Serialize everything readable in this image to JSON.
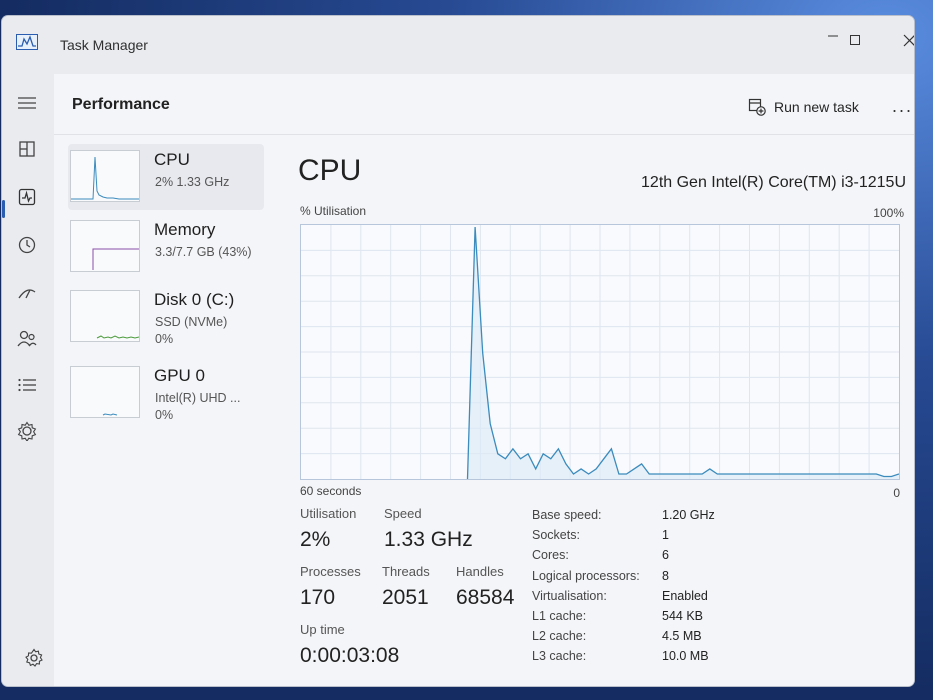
{
  "window": {
    "title": "Task Manager"
  },
  "header": {
    "title": "Performance",
    "run_new_task": "Run new task",
    "more": "..."
  },
  "sidebar": {
    "icons": [
      "hamburger-menu-icon",
      "processes-icon",
      "performance-icon",
      "app-history-icon",
      "startup-apps-icon",
      "users-icon",
      "details-icon",
      "services-icon",
      "settings-icon"
    ],
    "active": "performance-icon"
  },
  "perf_list": [
    {
      "name": "CPU",
      "line1": "2% 1.33 GHz",
      "line2": "",
      "color": "#3b8bbd",
      "selected": true
    },
    {
      "name": "Memory",
      "line1": "3.3/7.7 GB (43%)",
      "line2": "",
      "color": "#8b4fa8",
      "selected": false
    },
    {
      "name": "Disk 0 (C:)",
      "line1": "SSD (NVMe)",
      "line2": "0%",
      "color": "#4b9a3b",
      "selected": false
    },
    {
      "name": "GPU 0",
      "line1": "Intel(R) UHD ...",
      "line2": "0%",
      "color": "#3b8bbd",
      "selected": false
    }
  ],
  "detail": {
    "title": "CPU",
    "model": "12th Gen Intel(R) Core(TM) i3-1215U",
    "util_label": "% Utilisation",
    "max_label": "100%",
    "time_label": "60 seconds",
    "zero_label": "0",
    "stats": {
      "utilisation_label": "Utilisation",
      "utilisation": "2%",
      "speed_label": "Speed",
      "speed": "1.33 GHz",
      "processes_label": "Processes",
      "processes": "170",
      "threads_label": "Threads",
      "threads": "2051",
      "handles_label": "Handles",
      "handles": "68584",
      "uptime_label": "Up time",
      "uptime": "0:00:03:08"
    },
    "specs": [
      {
        "key": "Base speed:",
        "value": "1.20 GHz"
      },
      {
        "key": "Sockets:",
        "value": "1"
      },
      {
        "key": "Cores:",
        "value": "6"
      },
      {
        "key": "Logical processors:",
        "value": "8"
      },
      {
        "key": "Virtualisation:",
        "value": "Enabled"
      },
      {
        "key": "L1 cache:",
        "value": "544 KB"
      },
      {
        "key": "L2 cache:",
        "value": "4.5 MB"
      },
      {
        "key": "L3 cache:",
        "value": "10.0 MB"
      }
    ]
  },
  "colors": {
    "cpu_line": "#3b8bbd",
    "cpu_fill": "#dbe9f6",
    "grid": "#dfe6ef",
    "accent": "#2a5db0"
  },
  "chart_data": {
    "type": "area",
    "title": "",
    "xlabel": "60 seconds",
    "ylabel": "% Utilisation",
    "xlim": [
      60,
      0
    ],
    "ylim": [
      0,
      100
    ],
    "grid": true,
    "series": [
      {
        "values": [
          0,
          0,
          0,
          0,
          0,
          0,
          0,
          0,
          0,
          0,
          0,
          0,
          0,
          0,
          0,
          0,
          0,
          0,
          0,
          0,
          0,
          0,
          0,
          100,
          50,
          22,
          10,
          8,
          12,
          8,
          10,
          4,
          10,
          8,
          12,
          6,
          2,
          4,
          2,
          4,
          8,
          12,
          2,
          2,
          4,
          6,
          2,
          2,
          2,
          2,
          2,
          2,
          2,
          2,
          4,
          2,
          2,
          2,
          2,
          2,
          2,
          2,
          2,
          2,
          2,
          2,
          2,
          2,
          2,
          2,
          2,
          2,
          2,
          2,
          2,
          2,
          2,
          1,
          1,
          2
        ]
      }
    ]
  }
}
